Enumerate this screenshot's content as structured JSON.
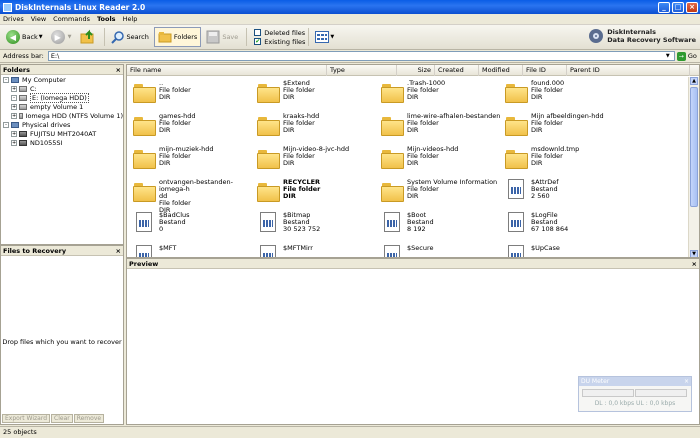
{
  "window": {
    "title": "DiskInternals Linux Reader 2.0"
  },
  "menu": [
    "Drives",
    "View",
    "Commands",
    "Tools",
    "Help"
  ],
  "toolbar": {
    "back": "Back",
    "search": "Search",
    "folders": "Folders",
    "save": "Save",
    "deleted_files": "Deleted files",
    "existing_files": "Existing files"
  },
  "brand": {
    "line1": "DiskInternals",
    "line2": "Data Recovery Software"
  },
  "address": {
    "label": "Address bar:",
    "value": "E:\\",
    "go": "Go"
  },
  "folders_panel": {
    "header": "Folders",
    "tree": [
      {
        "label": "My Computer",
        "level": 0,
        "icon": "computer-icon",
        "expander": "-"
      },
      {
        "label": "C:",
        "level": 1,
        "icon": "drive-icon",
        "expander": "+"
      },
      {
        "label": "E: (Iomega HDD)",
        "level": 1,
        "icon": "drive-icon",
        "expander": "-",
        "selected": true
      },
      {
        "label": "empty Volume 1",
        "level": 1,
        "icon": "drive-icon",
        "expander": "+"
      },
      {
        "label": "Iomega HDD (NTFS Volume 1)",
        "level": 1,
        "icon": "drive-icon",
        "expander": "+"
      },
      {
        "label": "Physical drives",
        "level": 0,
        "icon": "computer-icon",
        "expander": "-"
      },
      {
        "label": "FUJITSU MHT2040AT",
        "level": 1,
        "icon": "hard-drive-icon",
        "expander": "+"
      },
      {
        "label": "ND1055SI",
        "level": 1,
        "icon": "hard-drive-icon",
        "expander": "+"
      }
    ]
  },
  "recovery_panel": {
    "header": "Files to Recovery",
    "drop_text": "Drop files which you want to recover",
    "buttons": [
      "Export Wizard",
      "Clear",
      "Remove"
    ]
  },
  "filelist": {
    "columns": [
      "File name",
      "Type",
      "Size",
      "Created",
      "Modified",
      "File ID",
      "Parent ID"
    ],
    "items": [
      {
        "name": "..",
        "type": "File folder",
        "info": "DIR",
        "kind": "folder",
        "bold": false
      },
      {
        "name": "$Extend",
        "type": "File folder",
        "info": "DIR",
        "kind": "folder",
        "bold": false
      },
      {
        "name": ".Trash-1000",
        "type": "File folder",
        "info": "DIR",
        "kind": "folder",
        "bold": false
      },
      {
        "name": "found.000",
        "type": "File folder",
        "info": "DIR",
        "kind": "folder",
        "bold": false
      },
      {
        "name": "games-hdd",
        "type": "File folder",
        "info": "DIR",
        "kind": "folder",
        "bold": false
      },
      {
        "name": "kraaks-hdd",
        "type": "File folder",
        "info": "DIR",
        "kind": "folder",
        "bold": false
      },
      {
        "name": "lime-wire-afhalen-bestanden",
        "type": "File folder",
        "info": "DIR",
        "kind": "folder",
        "bold": false
      },
      {
        "name": "Mijn afbeeldingen-hdd",
        "type": "File folder",
        "info": "DIR",
        "kind": "folder",
        "bold": false
      },
      {
        "name": "mijn-muziek-hdd",
        "type": "File folder",
        "info": "DIR",
        "kind": "folder",
        "bold": false
      },
      {
        "name": "Mijn-video-8-jvc-hdd",
        "type": "File folder",
        "info": "DIR",
        "kind": "folder",
        "bold": false
      },
      {
        "name": "Mijn-videos-hdd",
        "type": "File folder",
        "info": "DIR",
        "kind": "folder",
        "bold": false
      },
      {
        "name": "msdownld.tmp",
        "type": "File folder",
        "info": "DIR",
        "kind": "folder",
        "bold": false
      },
      {
        "name": "ontvangen-bestanden-iomega-h",
        "name2": "dd",
        "type": "File folder",
        "info": "DIR",
        "kind": "folder",
        "bold": false
      },
      {
        "name": "RECYCLER",
        "type": "File folder",
        "info": "DIR",
        "kind": "folder",
        "bold": true
      },
      {
        "name": "System Volume Information",
        "type": "File folder",
        "info": "DIR",
        "kind": "folder",
        "bold": false
      },
      {
        "name": "$AttrDef",
        "type": "Bestand",
        "info": "2 560",
        "kind": "file",
        "bold": false
      },
      {
        "name": "$BadClus",
        "type": "Bestand",
        "info": "0",
        "kind": "file",
        "bold": false
      },
      {
        "name": "$Bitmap",
        "type": "Bestand",
        "info": "30 523 752",
        "kind": "file",
        "bold": false
      },
      {
        "name": "$Boot",
        "type": "Bestand",
        "info": "8 192",
        "kind": "file",
        "bold": false
      },
      {
        "name": "$LogFile",
        "type": "Bestand",
        "info": "67 108 864",
        "kind": "file",
        "bold": false
      },
      {
        "name": "$MFT",
        "type": "",
        "info": "",
        "kind": "file",
        "bold": false
      },
      {
        "name": "$MFTMirr",
        "type": "",
        "info": "",
        "kind": "file",
        "bold": false
      },
      {
        "name": "$Secure",
        "type": "",
        "info": "",
        "kind": "file",
        "bold": false
      },
      {
        "name": "$UpCase",
        "type": "",
        "info": "",
        "kind": "file",
        "bold": false
      }
    ]
  },
  "preview_panel": {
    "header": "Preview"
  },
  "meter": {
    "title": "DU Meter",
    "text": "DL : 0,0 kbps  UL : 0,0 kbps"
  },
  "status": {
    "text": "25 objects"
  }
}
